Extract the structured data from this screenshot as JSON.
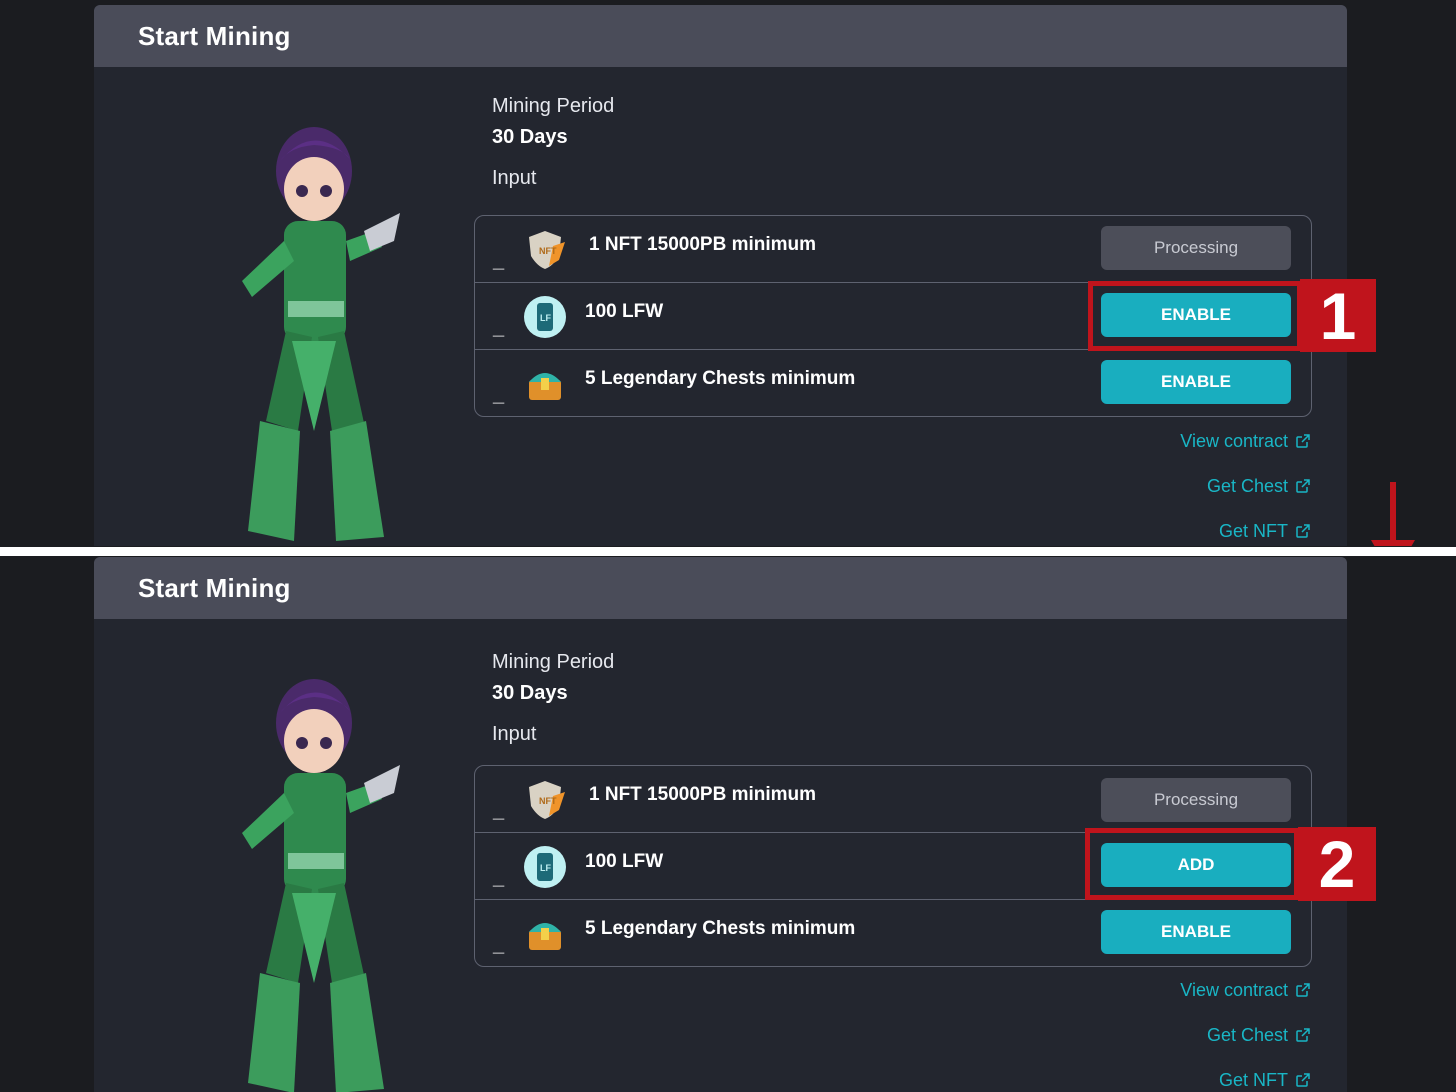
{
  "panels": [
    {
      "card_title": "Start Mining",
      "mining_period_label": "Mining Period",
      "mining_period_value": "30 Days",
      "input_label": "Input",
      "rows": [
        {
          "dash": "_",
          "icon": "nft-shield-icon",
          "text": "1 NFT 15000PB minimum",
          "button": "Processing",
          "button_state": "processing"
        },
        {
          "dash": "_",
          "icon": "lfw-token-icon",
          "text": "100 LFW",
          "button": "ENABLE",
          "button_state": "active"
        },
        {
          "dash": "_",
          "icon": "legendary-chest-icon",
          "text": "5 Legendary Chests minimum",
          "button": "ENABLE",
          "button_state": "active"
        }
      ],
      "links": [
        "View contract",
        "Get Chest",
        "Get NFT"
      ],
      "callout": "1"
    },
    {
      "card_title": "Start Mining",
      "mining_period_label": "Mining Period",
      "mining_period_value": "30 Days",
      "input_label": "Input",
      "rows": [
        {
          "dash": "_",
          "icon": "nft-shield-icon",
          "text": "1 NFT 15000PB minimum",
          "button": "Processing",
          "button_state": "processing"
        },
        {
          "dash": "_",
          "icon": "lfw-token-icon",
          "text": "100 LFW",
          "button": "ADD",
          "button_state": "active"
        },
        {
          "dash": "_",
          "icon": "legendary-chest-icon",
          "text": "5 Legendary Chests minimum",
          "button": "ENABLE",
          "button_state": "active"
        }
      ],
      "links": [
        "View contract",
        "Get Chest",
        "Get NFT"
      ],
      "callout": "2"
    }
  ],
  "colors": {
    "accent": "#19aebf",
    "link": "#19b6c6",
    "header": "#4a4c59",
    "card": "#23262f",
    "highlight": "#c0141c"
  }
}
